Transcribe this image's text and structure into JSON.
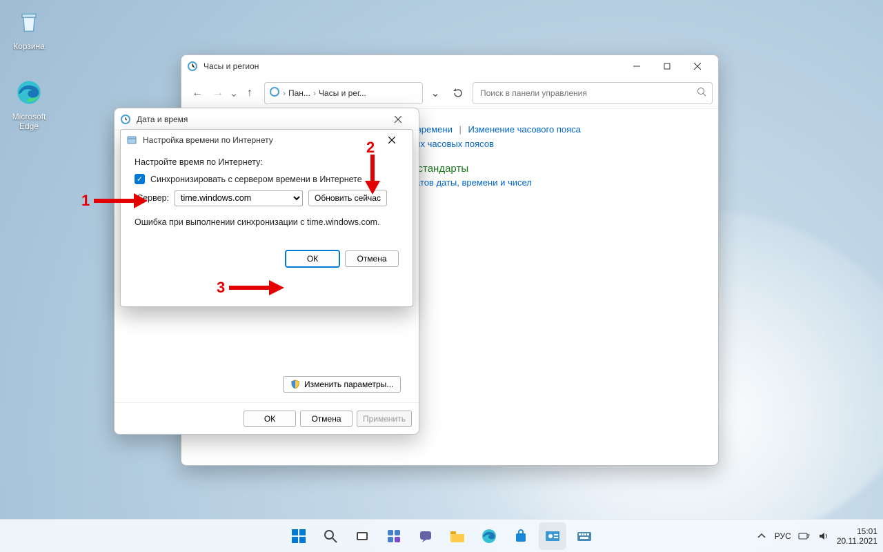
{
  "desktop": {
    "recycle": "Корзина",
    "edge": "Microsoft Edge"
  },
  "cp": {
    "title": "Часы и регион",
    "crumb1": "Пан...",
    "crumb2": "Часы и рег...",
    "search_placeholder": "Поиск в панели управления",
    "link1": "и времени",
    "link2": "Изменение часового пояса",
    "link3": "ных часовых поясов",
    "heading": "е стандарты",
    "sublink": "матов даты, времени и чисел"
  },
  "dt": {
    "title": "Дата и время",
    "changeParams": "Изменить параметры...",
    "ok": "ОК",
    "cancel": "Отмена",
    "apply": "Применить"
  },
  "it": {
    "title": "Настройка времени по Интернету",
    "prompt": "Настройте время по Интернету:",
    "cbLabel": "Синхронизировать с сервером времени в Интернете",
    "serverLabel": "Сервер:",
    "serverValue": "time.windows.com",
    "updateNow": "Обновить сейчас",
    "status": "Ошибка при выполнении синхронизации с time.windows.com.",
    "ok": "ОК",
    "cancel": "Отмена"
  },
  "tray": {
    "lang": "РУС",
    "time": "15:01",
    "date": "20.11.2021"
  },
  "annot": {
    "n1": "1",
    "n2": "2",
    "n3": "3"
  }
}
